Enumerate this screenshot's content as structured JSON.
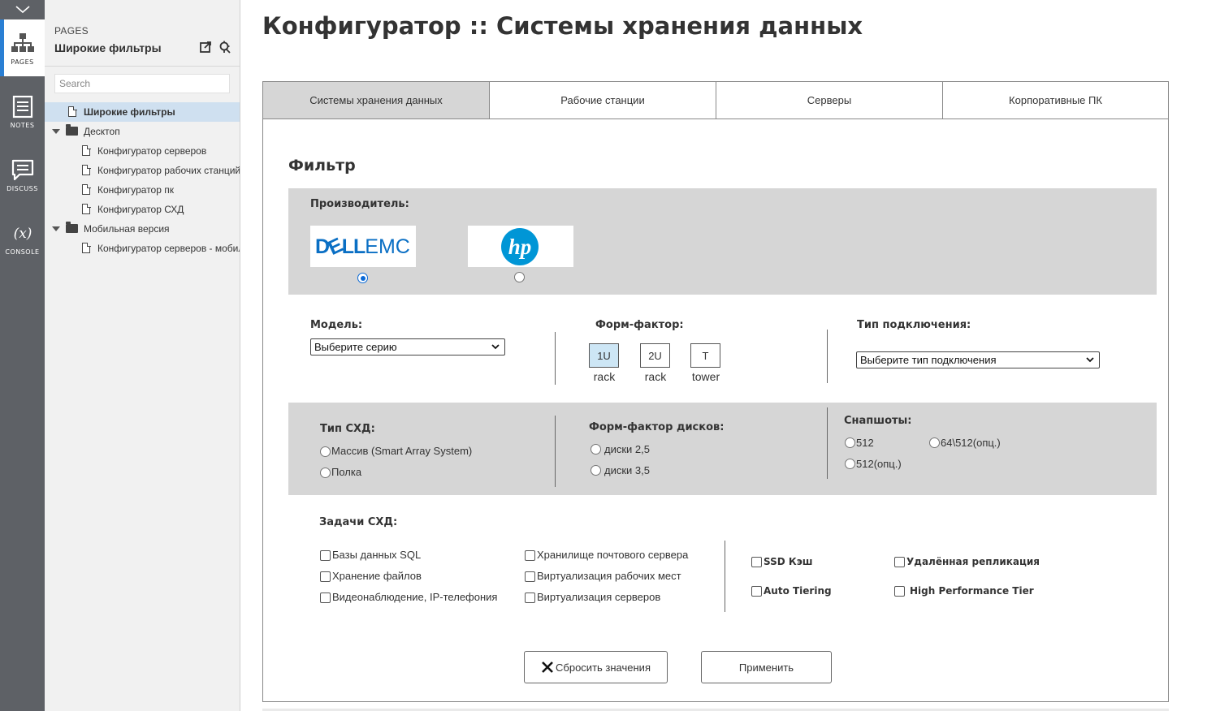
{
  "rail": {
    "items": [
      {
        "label": "PAGES",
        "icon": "sitemap-icon"
      },
      {
        "label": "NOTES",
        "icon": "notes-icon"
      },
      {
        "label": "DISCUSS",
        "icon": "discuss-icon"
      },
      {
        "label": "CONSOLE",
        "icon": "console-icon"
      }
    ]
  },
  "panel": {
    "kicker": "PAGES",
    "title": "Широкие фильтры",
    "search_placeholder": "Search",
    "tree": [
      {
        "label": "Широкие фильтры"
      },
      {
        "label": "Десктоп"
      },
      {
        "label": "Конфигуратор серверов"
      },
      {
        "label": "Конфигуратор рабочих станций"
      },
      {
        "label": "Конфигуратор пк"
      },
      {
        "label": "Конфигуратор СХД"
      },
      {
        "label": "Мобильная версия"
      },
      {
        "label": "Конфигуратор серверов - мобильная версия"
      }
    ]
  },
  "main": {
    "title": "Конфигуратор :: Системы хранения данных",
    "tabs": [
      {
        "label": "Системы хранения данных"
      },
      {
        "label": "Рабочие станции"
      },
      {
        "label": "Серверы"
      },
      {
        "label": "Корпоративные ПК"
      }
    ],
    "filter_title": "Фильтр",
    "manufacturer": {
      "label": "Производитель:",
      "options": [
        {
          "logo_text_a": "D",
          "logo_text_b": "LL",
          "logo_text_c": "EMC",
          "logo_e": "E",
          "selected": true
        },
        {
          "logo_text": "hp",
          "selected": false
        }
      ]
    },
    "model": {
      "label": "Модель:",
      "value": "Выберите серию"
    },
    "form_factor": {
      "label": "Форм-фактор:",
      "options": [
        {
          "code": "1U",
          "sub": "rack",
          "selected": true
        },
        {
          "code": "2U",
          "sub": "rack",
          "selected": false
        },
        {
          "code": "T",
          "sub": "tower",
          "selected": false
        }
      ]
    },
    "connection": {
      "label": "Тип подключения:",
      "value": "Выберите тип подключения"
    },
    "storage_type": {
      "label": "Тип СХД:",
      "options": [
        "Массив (Smart Array System)",
        "Полка"
      ]
    },
    "disk_form_factor": {
      "label": "Форм-фактор дисков:",
      "options": [
        "диски 2,5",
        "диски 3,5"
      ]
    },
    "snapshots": {
      "label": "Снапшоты:",
      "options": [
        "512",
        "64\\512(опц.)",
        "512(опц.)"
      ]
    },
    "tasks": {
      "label": "Задачи СХД:",
      "col1": [
        "Базы данных SQL",
        "Хранение файлов",
        "Видеонаблюдение, IP-телефония"
      ],
      "col2": [
        "Хранилище почтового сервера",
        "Виртуализация рабочих мест",
        "Виртуализация серверов"
      ],
      "features": [
        "SSD Кэш",
        "Удалённая репликация",
        "Auto Tiering",
        "High Performance Tier"
      ]
    },
    "buttons": {
      "reset": "Сбросить значения",
      "apply": "Применить"
    }
  }
}
